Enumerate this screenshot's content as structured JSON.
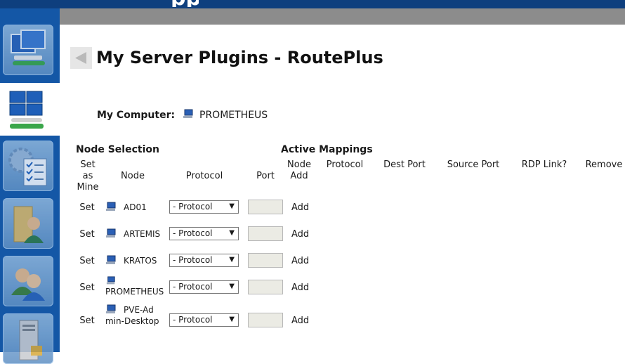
{
  "page": {
    "title": "My Server Plugins - RoutePlus",
    "top_glyph": "pp"
  },
  "my_computer": {
    "label": "My Computer:",
    "name": "PROMETHEUS"
  },
  "node_selection": {
    "heading": "Node Selection",
    "columns": {
      "set_as_mine": "Set as Mine",
      "node": "Node",
      "protocol": "Protocol",
      "port": "Port",
      "node_add": "Node Add"
    },
    "rows": [
      {
        "set": "Set",
        "node": "AD01",
        "protocol": "- Protocol",
        "port": "",
        "add": "Add"
      },
      {
        "set": "Set",
        "node": "ARTEMIS",
        "protocol": "- Protocol",
        "port": "",
        "add": "Add"
      },
      {
        "set": "Set",
        "node": "KRATOS",
        "protocol": "- Protocol",
        "port": "",
        "add": "Add"
      },
      {
        "set": "Set",
        "node": "PROMETHEUS",
        "protocol": "- Protocol",
        "port": "",
        "add": "Add"
      },
      {
        "set": "Set",
        "node": "PVE-Admin-Desktop",
        "protocol": "- Protocol",
        "port": "",
        "add": "Add"
      }
    ]
  },
  "active_mappings": {
    "heading": "Active Mappings",
    "columns": {
      "protocol": "Protocol",
      "dest_port": "Dest Port",
      "source_port": "Source Port",
      "rdp_link": "RDP Link?",
      "remove": "Remove"
    }
  },
  "sidebar": {
    "items": [
      {
        "icon": "network-computers-icon"
      },
      {
        "icon": "server-plugins-icon",
        "active": true
      },
      {
        "icon": "settings-checklist-icon"
      },
      {
        "icon": "user-folder-icon"
      },
      {
        "icon": "users-icon"
      },
      {
        "icon": "server-lock-icon"
      }
    ]
  },
  "colors": {
    "sidebar": "#1457a6",
    "topbar": "#0e3f7e",
    "greybar": "#8c8c8c"
  }
}
